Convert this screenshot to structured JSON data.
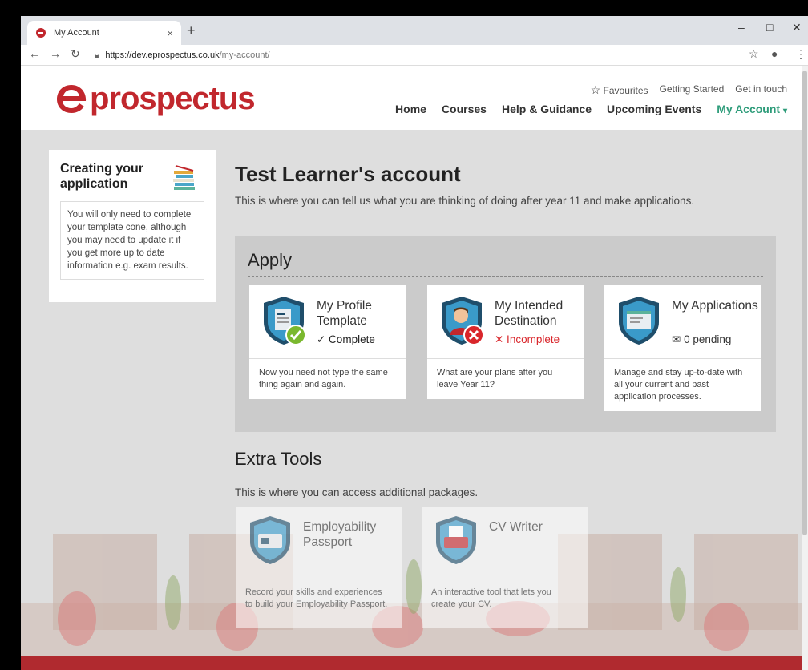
{
  "browser": {
    "tab_title": "My Account",
    "tab_close": "×",
    "new_tab": "+",
    "url_host": "https://dev.eprospectus.co.uk",
    "url_path": "/my-account/",
    "minimize": "–",
    "maximize": "□",
    "close": "✕"
  },
  "site": {
    "logo_text": "prospectus",
    "top_links": {
      "favourites": "Favourites",
      "getting_started": "Getting Started",
      "get_in_touch": "Get in touch"
    },
    "nav": {
      "home": "Home",
      "courses": "Courses",
      "help": "Help & Guidance",
      "events": "Upcoming Events",
      "account": "My Account"
    }
  },
  "sidebar": {
    "title": "Creating your application",
    "note": "You will only need to complete your template cone, although you may need to update it if you get more up to date information e.g. exam results."
  },
  "main": {
    "title": "Test Learner's account",
    "subtitle": "This is where you can tell us what you are thinking of doing after year 11 and make applications."
  },
  "apply": {
    "heading": "Apply",
    "cards": [
      {
        "name": "My Profile Template",
        "status": "✓ Complete",
        "desc": "Now you need not type the same thing again and again."
      },
      {
        "name": "My Intended Destination",
        "status": "✕ Incomplete",
        "desc": "What are your plans after you leave Year 11?"
      },
      {
        "name": "My Applications",
        "status": "0 pending",
        "desc": "Manage and stay up-to-date with all your current and past application processes."
      }
    ]
  },
  "extra": {
    "heading": "Extra Tools",
    "subtitle": "This is where you can access additional packages.",
    "cards": [
      {
        "name": "Employability Passport",
        "desc": "Record your skills and experiences to build your Employability Passport."
      },
      {
        "name": "CV Writer",
        "desc": "An interactive tool that lets you create your CV."
      }
    ]
  },
  "colors": {
    "brand_red": "#c1272d",
    "accent_green": "#2e9c7a",
    "complete_green": "#222222",
    "incomplete_red": "#d9262b"
  }
}
